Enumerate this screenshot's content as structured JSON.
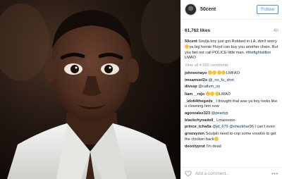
{
  "post": {
    "username": "50cent",
    "follow_label": "Follow",
    "likes": "61,762 likes",
    "age": "4h",
    "caption_user": "50cent",
    "caption_text_1": "Soulja boy just got Robbed in LA, don't worry ",
    "caption_text_2": "ya big homie Floyd can buy you another chain. But you bet not call POLICE little man. ",
    "caption_tag": "#thefightstillon",
    "caption_tail": " LMAO",
    "view_all": "View all 4,992 comments",
    "add_comment_placeholder": "Add a comment...",
    "more_label": "•••"
  },
  "comments": [
    {
      "user": "johnsonayo",
      "text": "LMFAO",
      "emoji": 4
    },
    {
      "user": "imsamuel2x",
      "mention": "@_no_fu_shxt"
    },
    {
      "user": "divssp",
      "mention": "@callum_oz"
    },
    {
      "user": "liam__rojo",
      "text": "LMAO",
      "emoji": 3
    },
    {
      "user": "_idolt4thegods_",
      "text": "I thought that was ya boy looks like u clowning him now"
    },
    {
      "user": "agonzalez323",
      "mention": "@pearlyp"
    },
    {
      "user": "blackchynadoll_",
      "text": "Lmaooooo"
    },
    {
      "user": "prince_tchalla",
      "mention": "@jd_679 @shezkhar96",
      "text": "I can't even"
    },
    {
      "user": "groovyzen",
      "text": "Souljah need to cop some voodoo to get the chicken back",
      "emoji": 1
    },
    {
      "user": "deonlyprut",
      "text": "I'm dead"
    }
  ],
  "colors": {
    "link": "#003569",
    "accent": "#3897f0",
    "muted": "#999999"
  }
}
